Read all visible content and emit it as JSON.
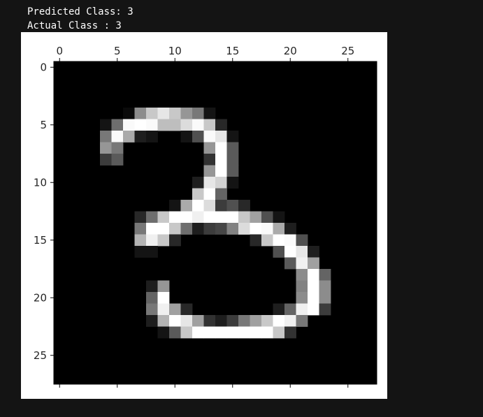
{
  "output": {
    "predicted_line": "Predicted Class: 3",
    "actual_line": "Actual Class : 3"
  },
  "colors": {
    "background": "#141414",
    "figure_bg": "#ffffff",
    "text": "#ffffff"
  },
  "chart_data": {
    "type": "heatmap",
    "colormap": "gray",
    "rows": 28,
    "cols": 28,
    "xlim": [
      -0.5,
      27.5
    ],
    "ylim": [
      27.5,
      -0.5
    ],
    "xticks": [
      0,
      5,
      10,
      15,
      20,
      25
    ],
    "yticks": [
      0,
      5,
      10,
      15,
      20,
      25
    ],
    "xtick_labels": [
      "0",
      "5",
      "10",
      "15",
      "20",
      "25"
    ],
    "ytick_labels": [
      "0",
      "5",
      "10",
      "15",
      "20",
      "25"
    ],
    "x_axis_position": "top",
    "grid": false,
    "pixels": [
      [
        0,
        0,
        0,
        0,
        0,
        0,
        0,
        0,
        0,
        0,
        0,
        0,
        0,
        0,
        0,
        0,
        0,
        0,
        0,
        0,
        0,
        0,
        0,
        0,
        0,
        0,
        0,
        0
      ],
      [
        0,
        0,
        0,
        0,
        0,
        0,
        0,
        0,
        0,
        0,
        0,
        0,
        0,
        0,
        0,
        0,
        0,
        0,
        0,
        0,
        0,
        0,
        0,
        0,
        0,
        0,
        0,
        0
      ],
      [
        0,
        0,
        0,
        0,
        0,
        0,
        0,
        0,
        0,
        0,
        0,
        0,
        0,
        0,
        0,
        0,
        0,
        0,
        0,
        0,
        0,
        0,
        0,
        0,
        0,
        0,
        0,
        0
      ],
      [
        0,
        0,
        0,
        0,
        0,
        0,
        0,
        0,
        0,
        0,
        0,
        0,
        0,
        0,
        0,
        0,
        0,
        0,
        0,
        0,
        0,
        0,
        0,
        0,
        0,
        0,
        0,
        0
      ],
      [
        0,
        0,
        0,
        0,
        0,
        0,
        10,
        140,
        200,
        230,
        200,
        150,
        120,
        20,
        0,
        0,
        0,
        0,
        0,
        0,
        0,
        0,
        0,
        0,
        0,
        0,
        0,
        0
      ],
      [
        0,
        0,
        0,
        0,
        20,
        110,
        250,
        255,
        250,
        190,
        190,
        220,
        250,
        200,
        40,
        0,
        0,
        0,
        0,
        0,
        0,
        0,
        0,
        0,
        0,
        0,
        0,
        0
      ],
      [
        0,
        0,
        0,
        0,
        120,
        250,
        170,
        30,
        20,
        0,
        0,
        20,
        80,
        250,
        230,
        20,
        0,
        0,
        0,
        0,
        0,
        0,
        0,
        0,
        0,
        0,
        0,
        0
      ],
      [
        0,
        0,
        0,
        0,
        150,
        120,
        0,
        0,
        0,
        0,
        0,
        0,
        0,
        150,
        255,
        90,
        0,
        0,
        0,
        0,
        0,
        0,
        0,
        0,
        0,
        0,
        0,
        0
      ],
      [
        0,
        0,
        0,
        0,
        60,
        90,
        0,
        0,
        0,
        0,
        0,
        0,
        0,
        50,
        255,
        90,
        0,
        0,
        0,
        0,
        0,
        0,
        0,
        0,
        0,
        0,
        0,
        0
      ],
      [
        0,
        0,
        0,
        0,
        0,
        0,
        0,
        0,
        0,
        0,
        0,
        0,
        0,
        150,
        255,
        90,
        0,
        0,
        0,
        0,
        0,
        0,
        0,
        0,
        0,
        0,
        0,
        0
      ],
      [
        0,
        0,
        0,
        0,
        0,
        0,
        0,
        0,
        0,
        0,
        0,
        0,
        30,
        230,
        210,
        20,
        0,
        0,
        0,
        0,
        0,
        0,
        0,
        0,
        0,
        0,
        0,
        0
      ],
      [
        0,
        0,
        0,
        0,
        0,
        0,
        0,
        0,
        0,
        0,
        0,
        0,
        200,
        255,
        100,
        0,
        0,
        0,
        0,
        0,
        0,
        0,
        0,
        0,
        0,
        0,
        0,
        0
      ],
      [
        0,
        0,
        0,
        0,
        0,
        0,
        0,
        0,
        0,
        0,
        20,
        170,
        255,
        220,
        60,
        80,
        40,
        0,
        0,
        0,
        0,
        0,
        0,
        0,
        0,
        0,
        0,
        0
      ],
      [
        0,
        0,
        0,
        0,
        0,
        0,
        0,
        40,
        110,
        200,
        255,
        255,
        240,
        255,
        255,
        255,
        200,
        160,
        80,
        20,
        0,
        0,
        0,
        0,
        0,
        0,
        0,
        0
      ],
      [
        0,
        0,
        0,
        0,
        0,
        0,
        0,
        120,
        255,
        255,
        200,
        110,
        30,
        60,
        70,
        130,
        220,
        255,
        250,
        170,
        30,
        0,
        0,
        0,
        0,
        0,
        0,
        0
      ],
      [
        0,
        0,
        0,
        0,
        0,
        0,
        0,
        180,
        240,
        200,
        40,
        0,
        0,
        0,
        0,
        0,
        0,
        40,
        200,
        255,
        250,
        80,
        0,
        0,
        0,
        0,
        0,
        0
      ],
      [
        0,
        0,
        0,
        0,
        0,
        0,
        0,
        20,
        20,
        0,
        0,
        0,
        0,
        0,
        0,
        0,
        0,
        0,
        0,
        80,
        255,
        230,
        30,
        0,
        0,
        0,
        0,
        0
      ],
      [
        0,
        0,
        0,
        0,
        0,
        0,
        0,
        0,
        0,
        0,
        0,
        0,
        0,
        0,
        0,
        0,
        0,
        0,
        0,
        0,
        90,
        240,
        160,
        0,
        0,
        0,
        0,
        0
      ],
      [
        0,
        0,
        0,
        0,
        0,
        0,
        0,
        0,
        0,
        0,
        0,
        0,
        0,
        0,
        0,
        0,
        0,
        0,
        0,
        0,
        0,
        140,
        255,
        100,
        0,
        0,
        0,
        0
      ],
      [
        0,
        0,
        0,
        0,
        0,
        0,
        0,
        0,
        30,
        150,
        0,
        0,
        0,
        0,
        0,
        0,
        0,
        0,
        0,
        0,
        0,
        130,
        255,
        140,
        0,
        0,
        0,
        0
      ],
      [
        0,
        0,
        0,
        0,
        0,
        0,
        0,
        0,
        100,
        255,
        0,
        0,
        0,
        0,
        0,
        0,
        0,
        0,
        0,
        0,
        0,
        140,
        255,
        140,
        0,
        0,
        0,
        0
      ],
      [
        0,
        0,
        0,
        0,
        0,
        0,
        0,
        0,
        120,
        240,
        160,
        40,
        0,
        0,
        0,
        0,
        0,
        0,
        0,
        30,
        100,
        240,
        255,
        60,
        0,
        0,
        0,
        0
      ],
      [
        0,
        0,
        0,
        0,
        0,
        0,
        0,
        0,
        30,
        180,
        255,
        230,
        160,
        50,
        30,
        60,
        120,
        160,
        200,
        255,
        240,
        120,
        0,
        0,
        0,
        0,
        0,
        0
      ],
      [
        0,
        0,
        0,
        0,
        0,
        0,
        0,
        0,
        0,
        20,
        90,
        200,
        255,
        255,
        255,
        255,
        255,
        255,
        255,
        200,
        50,
        0,
        0,
        0,
        0,
        0,
        0,
        0
      ],
      [
        0,
        0,
        0,
        0,
        0,
        0,
        0,
        0,
        0,
        0,
        0,
        0,
        0,
        0,
        0,
        0,
        0,
        0,
        0,
        0,
        0,
        0,
        0,
        0,
        0,
        0,
        0,
        0
      ],
      [
        0,
        0,
        0,
        0,
        0,
        0,
        0,
        0,
        0,
        0,
        0,
        0,
        0,
        0,
        0,
        0,
        0,
        0,
        0,
        0,
        0,
        0,
        0,
        0,
        0,
        0,
        0,
        0
      ],
      [
        0,
        0,
        0,
        0,
        0,
        0,
        0,
        0,
        0,
        0,
        0,
        0,
        0,
        0,
        0,
        0,
        0,
        0,
        0,
        0,
        0,
        0,
        0,
        0,
        0,
        0,
        0,
        0
      ],
      [
        0,
        0,
        0,
        0,
        0,
        0,
        0,
        0,
        0,
        0,
        0,
        0,
        0,
        0,
        0,
        0,
        0,
        0,
        0,
        0,
        0,
        0,
        0,
        0,
        0,
        0,
        0,
        0
      ]
    ]
  }
}
